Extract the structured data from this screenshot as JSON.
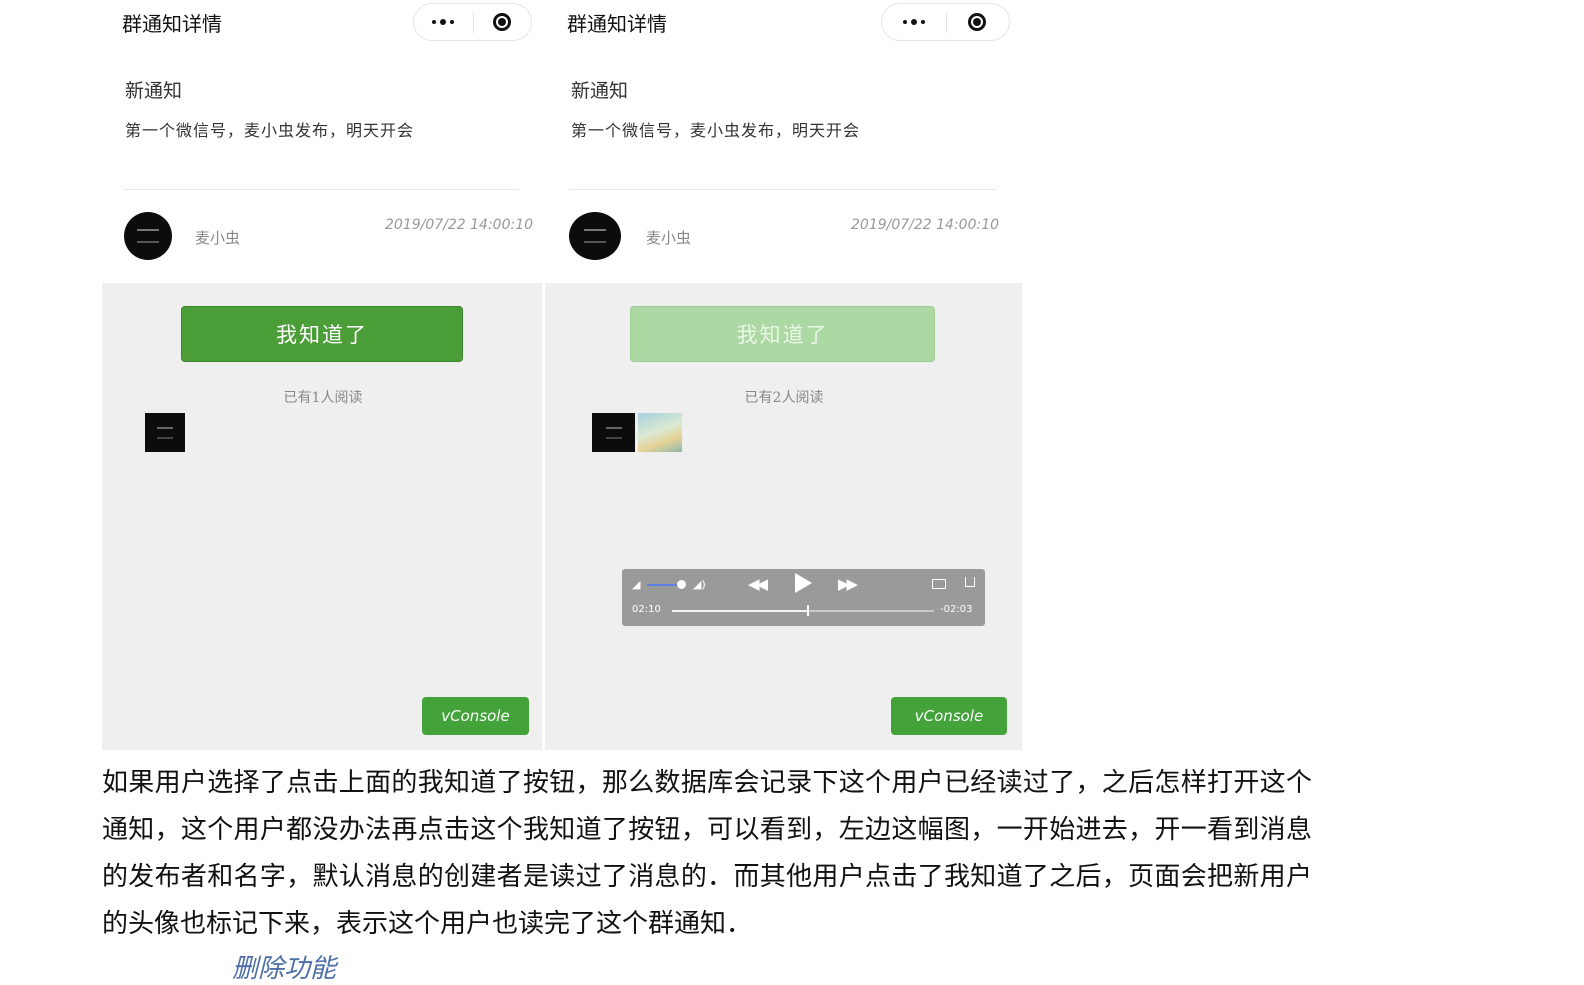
{
  "phones": {
    "left": {
      "nav_title": "群通知详情",
      "notice_title": "新通知",
      "notice_body": "第一个微信号，麦小虫发布，明天开会",
      "author": "麦小虫",
      "time": "2019/07/22 14:00:10",
      "button_label": "我知道了",
      "read_count": "已有1人阅读",
      "vconsole_label": "vConsole"
    },
    "right": {
      "nav_title": "群通知详情",
      "notice_title": "新通知",
      "notice_body": "第一个微信号，麦小虫发布，明天开会",
      "author": "麦小虫",
      "time": "2019/07/22 14:00:10",
      "button_label": "我知道了",
      "read_count": "已有2人阅读",
      "vconsole_label": "vConsole",
      "player": {
        "elapsed": "02:10",
        "remaining": "-02:03",
        "progress": 0.52,
        "volume": 0.9
      }
    }
  },
  "paragraph": "如果用户选择了点击上面的我知道了按钮，那么数据库会记录下这个用户已经读过了，之后怎样打开这个通知，这个用户都没办法再点击这个我知道了按钮，可以看到，左边这幅图，一开始进去，开一看到消息的发布者和名字，默认消息的创建者是读过了消息的．而其他用户点击了我知道了之后，页面会把新用户的头像也标记下来，表示这个用户也读完了这个群通知．",
  "next_heading": "删除功能",
  "colors": {
    "primary_green": "#4a9d37",
    "disabled_green": "#acd8a4",
    "vconsole_green": "#43a33a"
  },
  "icons": [
    "more-icon",
    "close-capsule-icon",
    "volume-low-icon",
    "volume-high-icon",
    "rewind-icon",
    "play-icon",
    "fast-forward-icon",
    "airplay-icon",
    "share-icon"
  ]
}
